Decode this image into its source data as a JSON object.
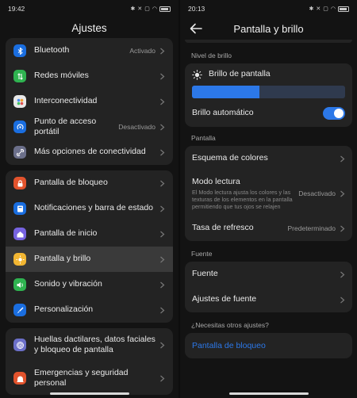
{
  "left": {
    "status": {
      "time": "19:42"
    },
    "title": "Ajustes",
    "groups": [
      [
        {
          "label": "Bluetooth",
          "value": "Activado",
          "icon": "bluetooth-icon",
          "color": "#1a6ee0"
        },
        {
          "label": "Redes móviles",
          "value": "",
          "icon": "mobile-data-icon",
          "color": "#2fb350"
        },
        {
          "label": "Interconectividad",
          "value": "",
          "icon": "interconnect-icon",
          "color": "#e8e8e8"
        },
        {
          "label": "Punto de acceso portátil",
          "value": "Desactivado",
          "icon": "hotspot-icon",
          "color": "#1a6ee0"
        },
        {
          "label": "Más opciones de conectividad",
          "value": "",
          "icon": "link-icon",
          "color": "#6b6f8a"
        }
      ],
      [
        {
          "label": "Pantalla de bloqueo",
          "value": "",
          "icon": "lock-icon",
          "color": "#e2532d"
        },
        {
          "label": "Notificaciones y barra de estado",
          "value": "",
          "icon": "notification-icon",
          "color": "#1a6ee0"
        },
        {
          "label": "Pantalla de inicio",
          "value": "",
          "icon": "home-icon",
          "color": "#7663e0"
        },
        {
          "label": "Pantalla y brillo",
          "value": "",
          "icon": "brightness-icon",
          "color": "#f2b632",
          "active": true
        },
        {
          "label": "Sonido y vibración",
          "value": "",
          "icon": "sound-icon",
          "color": "#2fb350"
        },
        {
          "label": "Personalización",
          "value": "",
          "icon": "brush-icon",
          "color": "#1a6ee0"
        }
      ],
      [
        {
          "label": "Huellas dactilares, datos faciales y bloqueo de pantalla",
          "value": "",
          "icon": "fingerprint-icon",
          "color": "#6b6fc8"
        },
        {
          "label": "Emergencias y seguridad personal",
          "value": "",
          "icon": "emergency-icon",
          "color": "#e2532d"
        }
      ]
    ]
  },
  "right": {
    "status": {
      "time": "20:13"
    },
    "title": "Pantalla y brillo",
    "brightness_section": "Nivel de brillo",
    "brightness_label": "Brillo de pantalla",
    "brightness_level": 0.44,
    "auto_brightness_label": "Brillo automático",
    "auto_brightness_on": true,
    "screen_section": "Pantalla",
    "color_scheme": "Esquema de colores",
    "reading_mode": "Modo lectura",
    "reading_mode_desc": "El Modo lectura ajusta los colores y las texturas de los elementos en la pantalla permitiendo que tus ojos se relajen",
    "reading_mode_value": "Desactivado",
    "refresh_rate": "Tasa de refresco",
    "refresh_rate_value": "Predeterminado",
    "font_section": "Fuente",
    "font": "Fuente",
    "font_settings": "Ajustes de fuente",
    "other_section": "¿Necesitas otros ajustes?",
    "lockscreen_link": "Pantalla de bloqueo"
  },
  "colors": {
    "accent": "#2c78e8",
    "card": "#232323",
    "background": "#131313"
  }
}
